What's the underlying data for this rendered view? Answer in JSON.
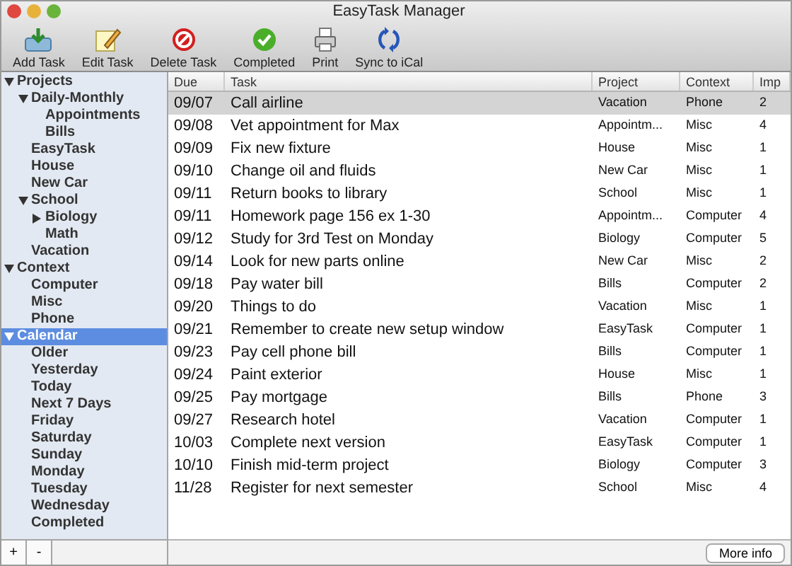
{
  "window": {
    "title": "EasyTask Manager"
  },
  "toolbar": [
    {
      "label": "Add Task",
      "kind": "add"
    },
    {
      "label": "Edit Task",
      "kind": "edit"
    },
    {
      "label": "Delete Task",
      "kind": "delete"
    },
    {
      "label": "Completed",
      "kind": "complete"
    },
    {
      "label": "Print",
      "kind": "print"
    },
    {
      "label": "Sync to iCal",
      "kind": "sync"
    }
  ],
  "sidebar": {
    "items": [
      {
        "label": "Projects",
        "expanded": true,
        "selected": false,
        "children": [
          {
            "label": "Daily-Monthly",
            "expanded": true,
            "selected": false,
            "children": [
              {
                "label": "Appointments",
                "selected": false
              },
              {
                "label": "Bills",
                "selected": false
              }
            ]
          },
          {
            "label": "EasyTask",
            "selected": false
          },
          {
            "label": "House",
            "selected": false
          },
          {
            "label": "New Car",
            "selected": false
          },
          {
            "label": "School",
            "expanded": true,
            "selected": false,
            "children": [
              {
                "label": "Biology",
                "expanded": false,
                "selected": false
              },
              {
                "label": "Math",
                "selected": false
              }
            ]
          },
          {
            "label": "Vacation",
            "selected": false
          }
        ]
      },
      {
        "label": "Context",
        "expanded": true,
        "selected": false,
        "children": [
          {
            "label": "Computer",
            "selected": false
          },
          {
            "label": "Misc",
            "selected": false
          },
          {
            "label": "Phone",
            "selected": false
          }
        ]
      },
      {
        "label": "Calendar",
        "expanded": true,
        "selected": true,
        "children": [
          {
            "label": "Older",
            "selected": false
          },
          {
            "label": "Yesterday",
            "selected": false
          },
          {
            "label": "Today",
            "selected": false
          },
          {
            "label": "Next 7 Days",
            "selected": false
          },
          {
            "label": "Friday",
            "selected": false
          },
          {
            "label": "Saturday",
            "selected": false
          },
          {
            "label": "Sunday",
            "selected": false
          },
          {
            "label": "Monday",
            "selected": false
          },
          {
            "label": "Tuesday",
            "selected": false
          },
          {
            "label": "Wednesday",
            "selected": false
          },
          {
            "label": "Completed",
            "selected": false
          }
        ]
      }
    ],
    "buttons": [
      "+",
      "-"
    ]
  },
  "table": {
    "columns": [
      "Due",
      "Task",
      "Project",
      "Context",
      "Imp"
    ],
    "rows": [
      {
        "cells": [
          "09/07",
          "Call airline",
          "Vacation",
          "Phone",
          "2"
        ],
        "selected": true
      },
      {
        "cells": [
          "09/08",
          "Vet appointment for Max",
          "Appointm...",
          "Misc",
          "4"
        ],
        "selected": false
      },
      {
        "cells": [
          "09/09",
          "Fix new fixture",
          "House",
          "Misc",
          "1"
        ],
        "selected": false
      },
      {
        "cells": [
          "09/10",
          "Change oil and fluids",
          "New Car",
          "Misc",
          "1"
        ],
        "selected": false
      },
      {
        "cells": [
          "09/11",
          "Return books to library",
          "School",
          "Misc",
          "1"
        ],
        "selected": false
      },
      {
        "cells": [
          "09/11",
          "Homework page 156 ex 1-30",
          "Appointm...",
          "Computer",
          "4"
        ],
        "selected": false
      },
      {
        "cells": [
          "09/12",
          "Study for 3rd Test on Monday",
          "Biology",
          "Computer",
          "5"
        ],
        "selected": false
      },
      {
        "cells": [
          "09/14",
          "Look for new parts online",
          "New Car",
          "Misc",
          "2"
        ],
        "selected": false
      },
      {
        "cells": [
          "09/18",
          "Pay water bill",
          "Bills",
          "Computer",
          "2"
        ],
        "selected": false
      },
      {
        "cells": [
          "09/20",
          "Things to do",
          "Vacation",
          "Misc",
          "1"
        ],
        "selected": false
      },
      {
        "cells": [
          "09/21",
          "Remember to create new setup window",
          "EasyTask",
          "Computer",
          "1"
        ],
        "selected": false
      },
      {
        "cells": [
          "09/23",
          "Pay cell phone bill",
          "Bills",
          "Computer",
          "1"
        ],
        "selected": false
      },
      {
        "cells": [
          "09/24",
          "Paint exterior",
          "House",
          "Misc",
          "1"
        ],
        "selected": false
      },
      {
        "cells": [
          "09/25",
          "Pay mortgage",
          "Bills",
          "Phone",
          "3"
        ],
        "selected": false
      },
      {
        "cells": [
          "09/27",
          "Research hotel",
          "Vacation",
          "Computer",
          "1"
        ],
        "selected": false
      },
      {
        "cells": [
          "10/03",
          "Complete next version",
          "EasyTask",
          "Computer",
          "1"
        ],
        "selected": false
      },
      {
        "cells": [
          "10/10",
          "Finish mid-term project",
          "Biology",
          "Computer",
          "3"
        ],
        "selected": false
      },
      {
        "cells": [
          "11/28",
          "Register for next semester",
          "School",
          "Misc",
          "4"
        ],
        "selected": false
      }
    ]
  },
  "footer": {
    "button": "More info"
  }
}
